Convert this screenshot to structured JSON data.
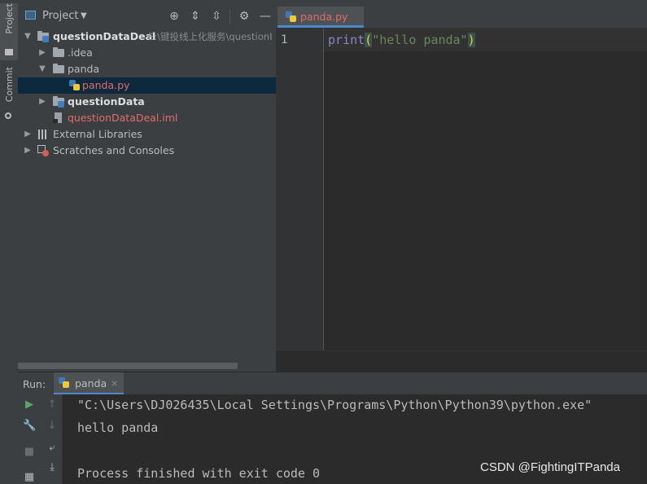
{
  "left_strip": {
    "project_tab": "Project",
    "commit_tab": "Commit"
  },
  "project_panel": {
    "title": "Project",
    "tree": [
      {
        "label": "questionDataDeal",
        "path": "E:\\键投线上化服务\\questionI",
        "kind": "project"
      },
      {
        "label": ".idea",
        "kind": "folder"
      },
      {
        "label": "panda",
        "kind": "folder"
      },
      {
        "label": "panda.py",
        "kind": "python-file"
      },
      {
        "label": "questionData",
        "kind": "module"
      },
      {
        "label": "questionDataDeal.iml",
        "kind": "iml-file"
      },
      {
        "label": "External Libraries",
        "kind": "libraries"
      },
      {
        "label": "Scratches and Consoles",
        "kind": "scratches"
      }
    ]
  },
  "editor": {
    "tab_label": "panda.py",
    "line_number": "1",
    "code": {
      "func": "print",
      "open": "(",
      "string": "\"hello panda\"",
      "close": ")"
    }
  },
  "run_panel": {
    "label": "Run:",
    "tab_label": "panda",
    "close": "×",
    "console_lines": [
      "\"C:\\Users\\DJ026435\\Local Settings\\Programs\\Python\\Python39\\python.exe\"",
      "hello panda",
      "",
      "Process finished with exit code 0"
    ]
  },
  "watermark": "CSDN @FightingITPanda",
  "colors": {
    "accent": "#4a88c7",
    "error_file": "#e06c6c",
    "run_green": "#59a869"
  }
}
